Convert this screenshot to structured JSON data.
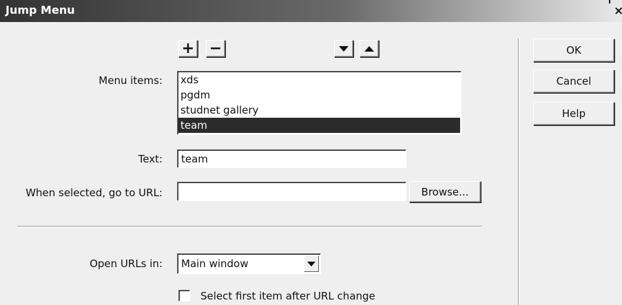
{
  "window": {
    "title": "Jump Menu",
    "close_glyph": "×"
  },
  "toolbar": {
    "add_label": "+",
    "remove_label": "−",
    "move_down_icon": "down-triangle",
    "move_up_icon": "up-triangle"
  },
  "menu_items": {
    "label": "Menu items:",
    "items": [
      "xds",
      "pgdm",
      "studnet gallery",
      "team"
    ],
    "selected_index": 3
  },
  "text_field": {
    "label": "Text:",
    "value": "team"
  },
  "url_field": {
    "label": "When selected, go to URL:",
    "value": "",
    "browse_label": "Browse..."
  },
  "open_in": {
    "label": "Open URLs in:",
    "selected": "Main window"
  },
  "checkbox": {
    "label": "Select first item after URL change",
    "checked": false
  },
  "buttons": {
    "ok": "OK",
    "cancel": "Cancel",
    "help": "Help"
  },
  "colors": {
    "selection": "#2b2b2b",
    "dialog_bg": "#efefef",
    "titlebar": "#333333"
  }
}
